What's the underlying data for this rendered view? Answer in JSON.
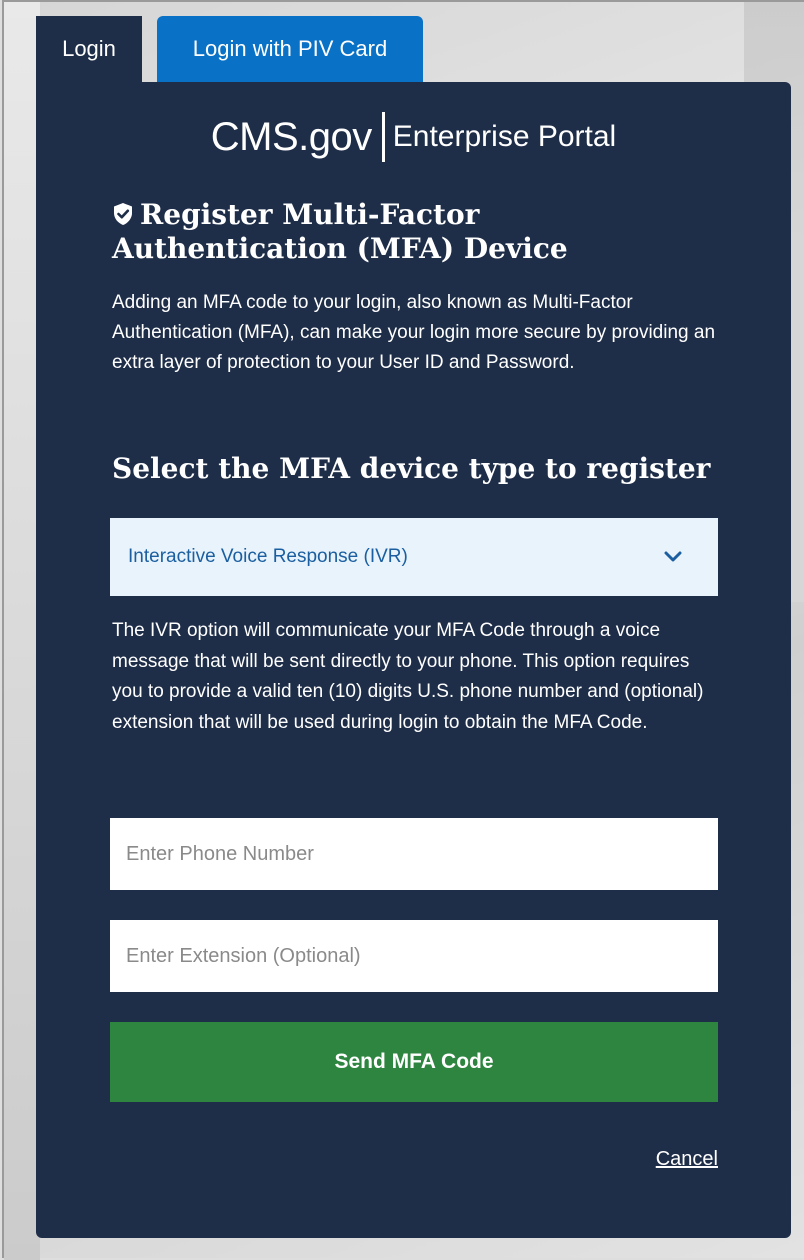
{
  "tabs": [
    {
      "label": "Login",
      "active": true
    },
    {
      "label": "Login with PIV Card",
      "active": false
    }
  ],
  "brand": {
    "name": "CMS.gov",
    "portal": "Enterprise Portal"
  },
  "heading": {
    "icon": "shield-check-icon",
    "title": "Register Multi-Factor Authentication (MFA) Device"
  },
  "intro_text": "Adding an MFA code to your login, also known as Multi-Factor Authentication (MFA), can make your login more secure by providing an extra layer of protection to your User ID and Password.",
  "device_select": {
    "label": "Select the MFA device type to register",
    "selected": "Interactive Voice Response (IVR)",
    "icon": "chevron-down-icon"
  },
  "ivr_description": "The IVR option will communicate your MFA Code through a voice message that will be sent directly to your phone. This option requires you to provide a valid ten (10) digits U.S. phone number and (optional) extension that will be used during login to obtain the MFA Code.",
  "phone_input": {
    "placeholder": "Enter Phone Number",
    "value": ""
  },
  "extension_input": {
    "placeholder": "Enter Extension (Optional)",
    "value": ""
  },
  "send_button": {
    "label": "Send MFA Code"
  },
  "cancel_link": {
    "label": "Cancel"
  },
  "colors": {
    "card_bg": "#1e2d48",
    "tab_piv_bg": "#0a72c6",
    "select_bg": "#e8f3fb",
    "select_text": "#1b5fa0",
    "send_button_bg": "#2e8540"
  }
}
